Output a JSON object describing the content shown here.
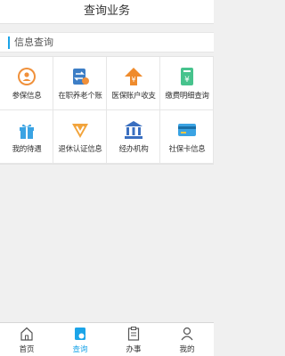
{
  "header": {
    "title": "查询业务"
  },
  "section": {
    "label": "信息查询"
  },
  "grid": {
    "items": [
      {
        "label": "参保信息",
        "icon": "person-icon",
        "color": "#f0903a"
      },
      {
        "label": "在职养老个账",
        "icon": "transfer-icon",
        "color": "#3d7ec6"
      },
      {
        "label": "医保账户收支",
        "icon": "yuan-arrow-icon",
        "color": "#ef8b2c"
      },
      {
        "label": "缴费明细查询",
        "icon": "receipt-icon",
        "color": "#47c38d"
      },
      {
        "label": "我的待遇",
        "icon": "gift-icon",
        "color": "#3aa3e3"
      },
      {
        "label": "退休认证信息",
        "icon": "v-badge-icon",
        "color": "#f2a43c"
      },
      {
        "label": "经办机构",
        "icon": "institution-icon",
        "color": "#3a6fc0"
      },
      {
        "label": "社保卡信息",
        "icon": "card-icon",
        "color": "#3aa3e3"
      }
    ]
  },
  "tabbar": {
    "tabs": [
      {
        "label": "首页",
        "icon": "home-icon",
        "active": false
      },
      {
        "label": "查询",
        "icon": "search-doc-icon",
        "active": true
      },
      {
        "label": "办事",
        "icon": "clipboard-icon",
        "active": false
      },
      {
        "label": "我的",
        "icon": "user-icon",
        "active": false
      }
    ]
  },
  "colors": {
    "accent": "#1ba4e8",
    "background": "#f0f0f0"
  }
}
